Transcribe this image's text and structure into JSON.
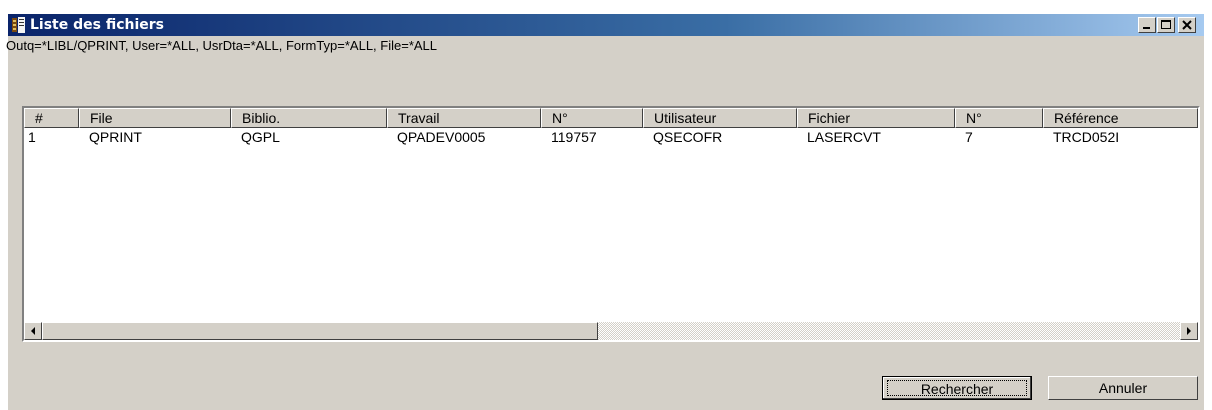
{
  "window": {
    "title": "Liste des fichiers",
    "title_bar_color": "#0a246a"
  },
  "subheader": "Outq=*LIBL/QPRINT, User=*ALL, UsrDta=*ALL, FormTyp=*ALL, File=*ALL",
  "table": {
    "columns": [
      "#",
      "File",
      "Biblio.",
      "Travail",
      "N°",
      "Utilisateur",
      "Fichier",
      "N°",
      "Référence"
    ],
    "rows": [
      [
        "1",
        "QPRINT",
        "QGPL",
        "QPADEV0005",
        "119757",
        "QSECOFR",
        "LASERCVT",
        "7",
        "TRCD052I"
      ]
    ]
  },
  "buttons": {
    "search": "Rechercher",
    "cancel": "Annuler"
  },
  "icons": {
    "app": "app-icon",
    "minimize": "minimize-icon",
    "maximize": "maximize-icon",
    "close": "close-icon",
    "scroll_left": "arrow-left-icon",
    "scroll_right": "arrow-right-icon"
  }
}
